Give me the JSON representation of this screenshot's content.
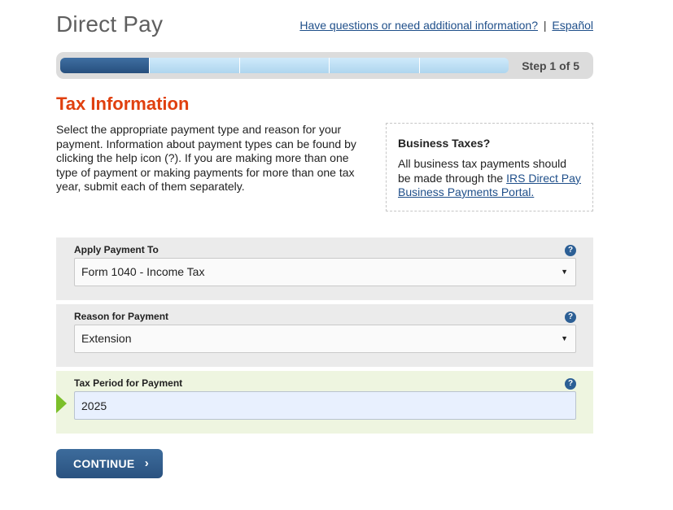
{
  "header": {
    "title": "Direct Pay",
    "help_link": "Have questions or need additional information?",
    "separator": "|",
    "language_link": "Español"
  },
  "progress": {
    "step_label": "Step 1 of 5",
    "current_step": 1,
    "total_steps": 5,
    "completed_color": "#274f7d",
    "pending_color": "#bfe0f4"
  },
  "section": {
    "title": "Tax Information",
    "intro": "Select the appropriate payment type and reason for your payment. Information about payment types can be found by clicking the help icon (?). If you are making more than one type of payment or making payments for more than one tax year, submit each of them separately."
  },
  "callout": {
    "title": "Business Taxes?",
    "text_before": "All business tax payments should be made through the ",
    "link": "IRS Direct Pay Business Payments Portal."
  },
  "fields": {
    "apply_payment_to": {
      "label": "Apply Payment To",
      "value": "Form 1040 - Income Tax",
      "help": "?"
    },
    "reason_for_payment": {
      "label": "Reason for Payment",
      "value": "Extension",
      "help": "?"
    },
    "tax_period": {
      "label": "Tax Period for Payment",
      "value": "2025",
      "help": "?"
    }
  },
  "actions": {
    "continue_label": "CONTINUE",
    "continue_icon": "›"
  },
  "icons": {
    "help": "help-icon",
    "dropdown": "chevron-down-icon",
    "active_field": "arrow-right-icon",
    "continue": "chevron-right-icon"
  },
  "colors": {
    "accent_title": "#e0400f",
    "link": "#1f4f8a",
    "button": "#2a5280",
    "active_marker": "#7bbf2a"
  }
}
